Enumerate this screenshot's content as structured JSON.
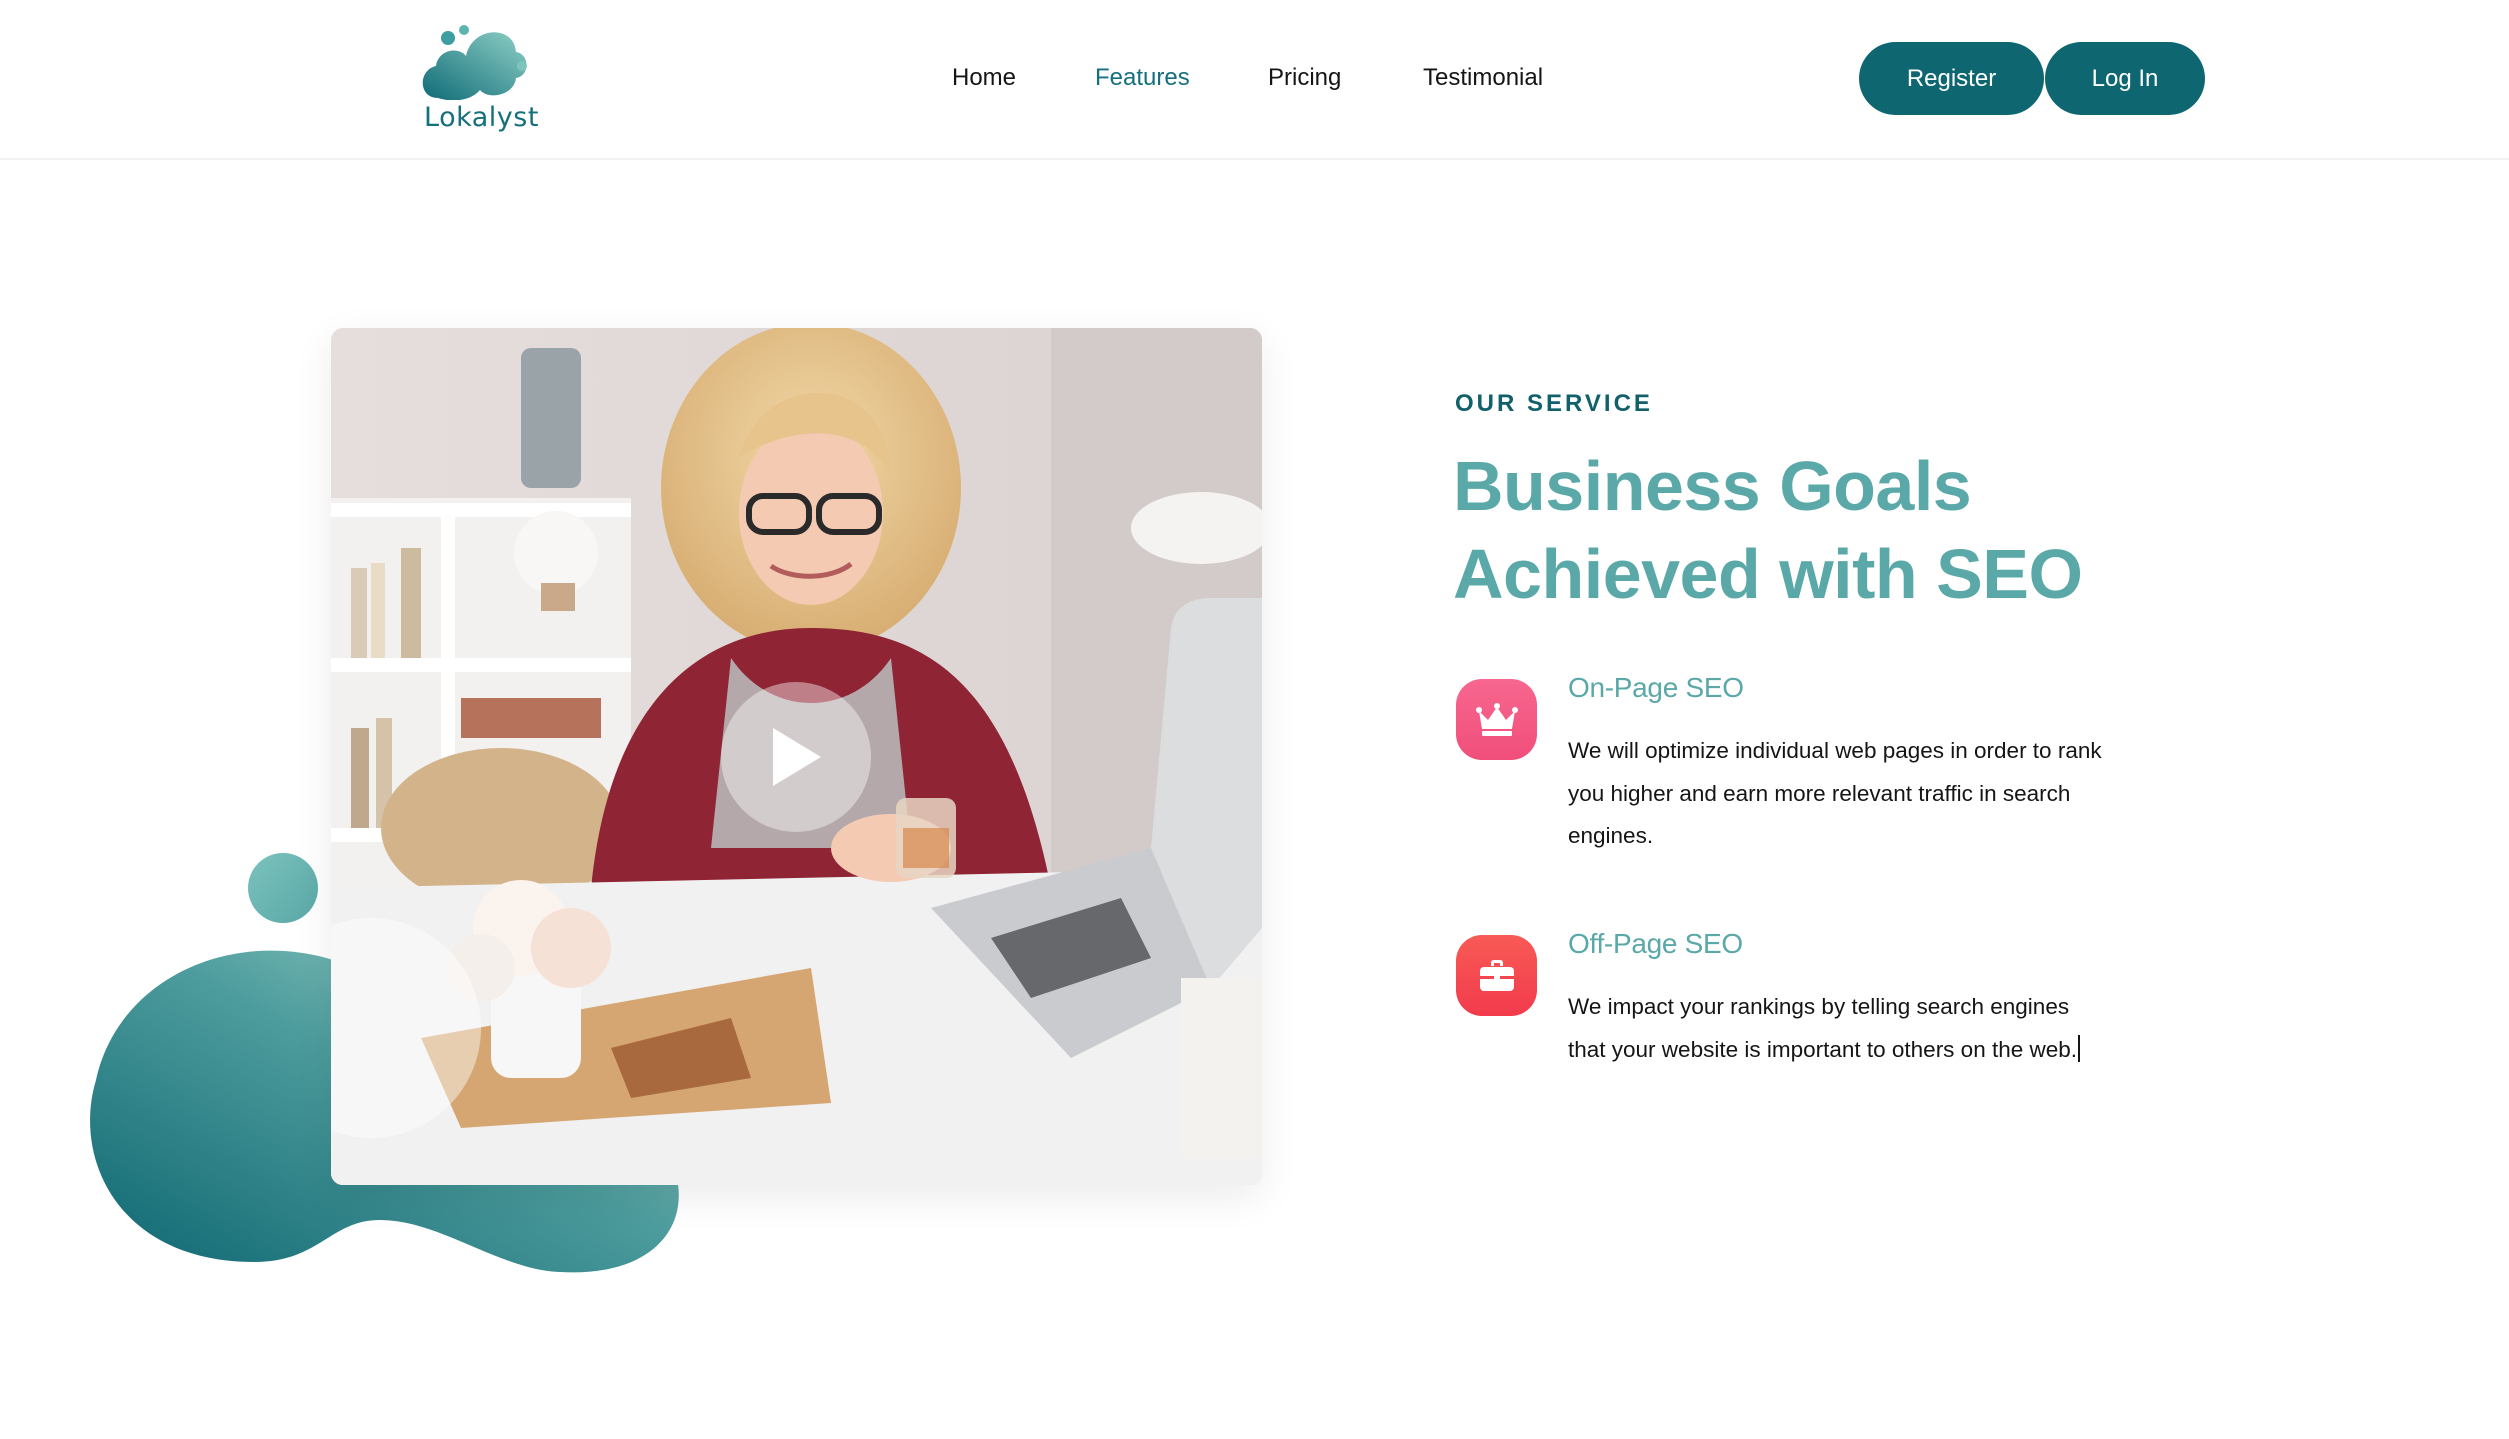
{
  "brand": {
    "name": "Lokalyst",
    "colors": {
      "primary": "#0d6670",
      "accent": "#5aa8a7",
      "pink": "#f45a86",
      "red": "#f6444f"
    }
  },
  "nav": {
    "items": [
      {
        "label": "Home",
        "active": false
      },
      {
        "label": "Features",
        "active": true
      },
      {
        "label": "Pricing",
        "active": false
      },
      {
        "label": "Testimonial",
        "active": false
      }
    ],
    "register_label": "Register",
    "login_label": "Log In"
  },
  "service": {
    "eyebrow": "OUR SERVICE",
    "headline": "Business Goals Achieved with SEO",
    "features": [
      {
        "icon": "crown-icon",
        "title": "On-Page SEO",
        "description": "We will optimize individual web pages in order to rank you higher and earn more relevant traffic in search engines."
      },
      {
        "icon": "briefcase-icon",
        "title": "Off-Page SEO",
        "description": "We impact your rankings by telling search engines that your website is important to others on the web."
      }
    ]
  },
  "media": {
    "image": "woman-at-desk-with-laptop-photo",
    "play_icon": "play-icon"
  }
}
